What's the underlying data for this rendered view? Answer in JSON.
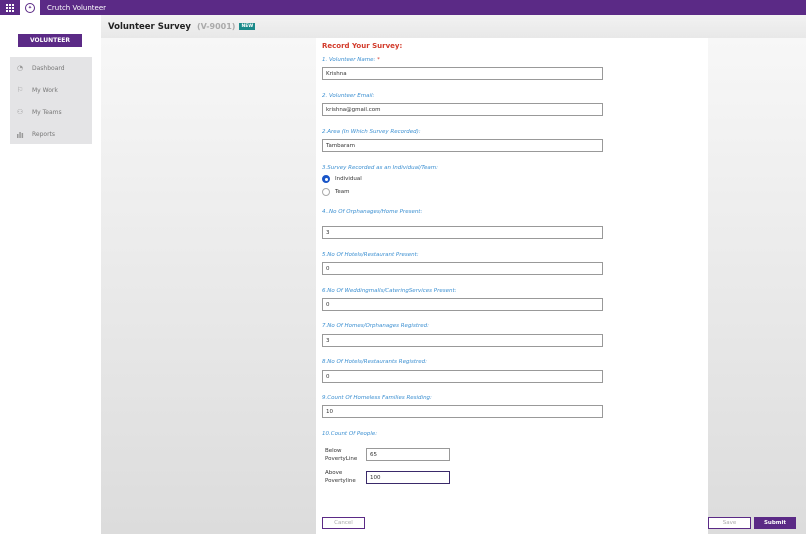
{
  "app": {
    "title": "Crutch Volunteer"
  },
  "sidebar": {
    "role_button": "VOLUNTEER",
    "items": [
      {
        "label": "Dashboard",
        "icon": "dashboard-icon"
      },
      {
        "label": "My Work",
        "icon": "flag-icon"
      },
      {
        "label": "My Teams",
        "icon": "team-icon"
      },
      {
        "label": "Reports",
        "icon": "bar-chart-icon"
      }
    ]
  },
  "header": {
    "title": "Volunteer Survey",
    "code": "(V-9001)",
    "badge": "NEW"
  },
  "form": {
    "heading": "Record Your Survey:",
    "q1": {
      "label": "1. Volunteer Name:",
      "required": "*",
      "value": "Krishna"
    },
    "q2": {
      "label": "2. Volunteer Email:",
      "value": "krishna@gmail.com"
    },
    "q3": {
      "label": "2.Area (In Which Survey Recorded):",
      "value": "Tambaram"
    },
    "q4": {
      "label": "3.Survey Recorded as an Individual/Team:",
      "options": [
        "Individual",
        "Team"
      ],
      "selected": "Individual"
    },
    "q5": {
      "label": "4..No Of Orphanages/Home Present:",
      "value": "3"
    },
    "q6": {
      "label": "5.No Of Hotels/Restaurant Present:",
      "value": "0"
    },
    "q7": {
      "label": "6.No Of Weddingmalls/CateringServices Present:",
      "value": "0"
    },
    "q8": {
      "label": "7.No Of Homes/Orphanages Registred:",
      "value": "3"
    },
    "q9": {
      "label": "8.No Of Hotels/Restaurants Registred:",
      "value": "0"
    },
    "q10": {
      "label": "9.Count Of Homeless Families Residing:",
      "value": "10"
    },
    "q11": {
      "label": "10.Count Of People:",
      "below_label_1": "Below",
      "below_label_2": "PovertyLine",
      "below_value": "65",
      "above_label_1": "Above",
      "above_label_2": "Povertyline",
      "above_value": "100"
    },
    "buttons": {
      "cancel": "Cancel",
      "save": "Save",
      "submit": "Submit"
    }
  }
}
